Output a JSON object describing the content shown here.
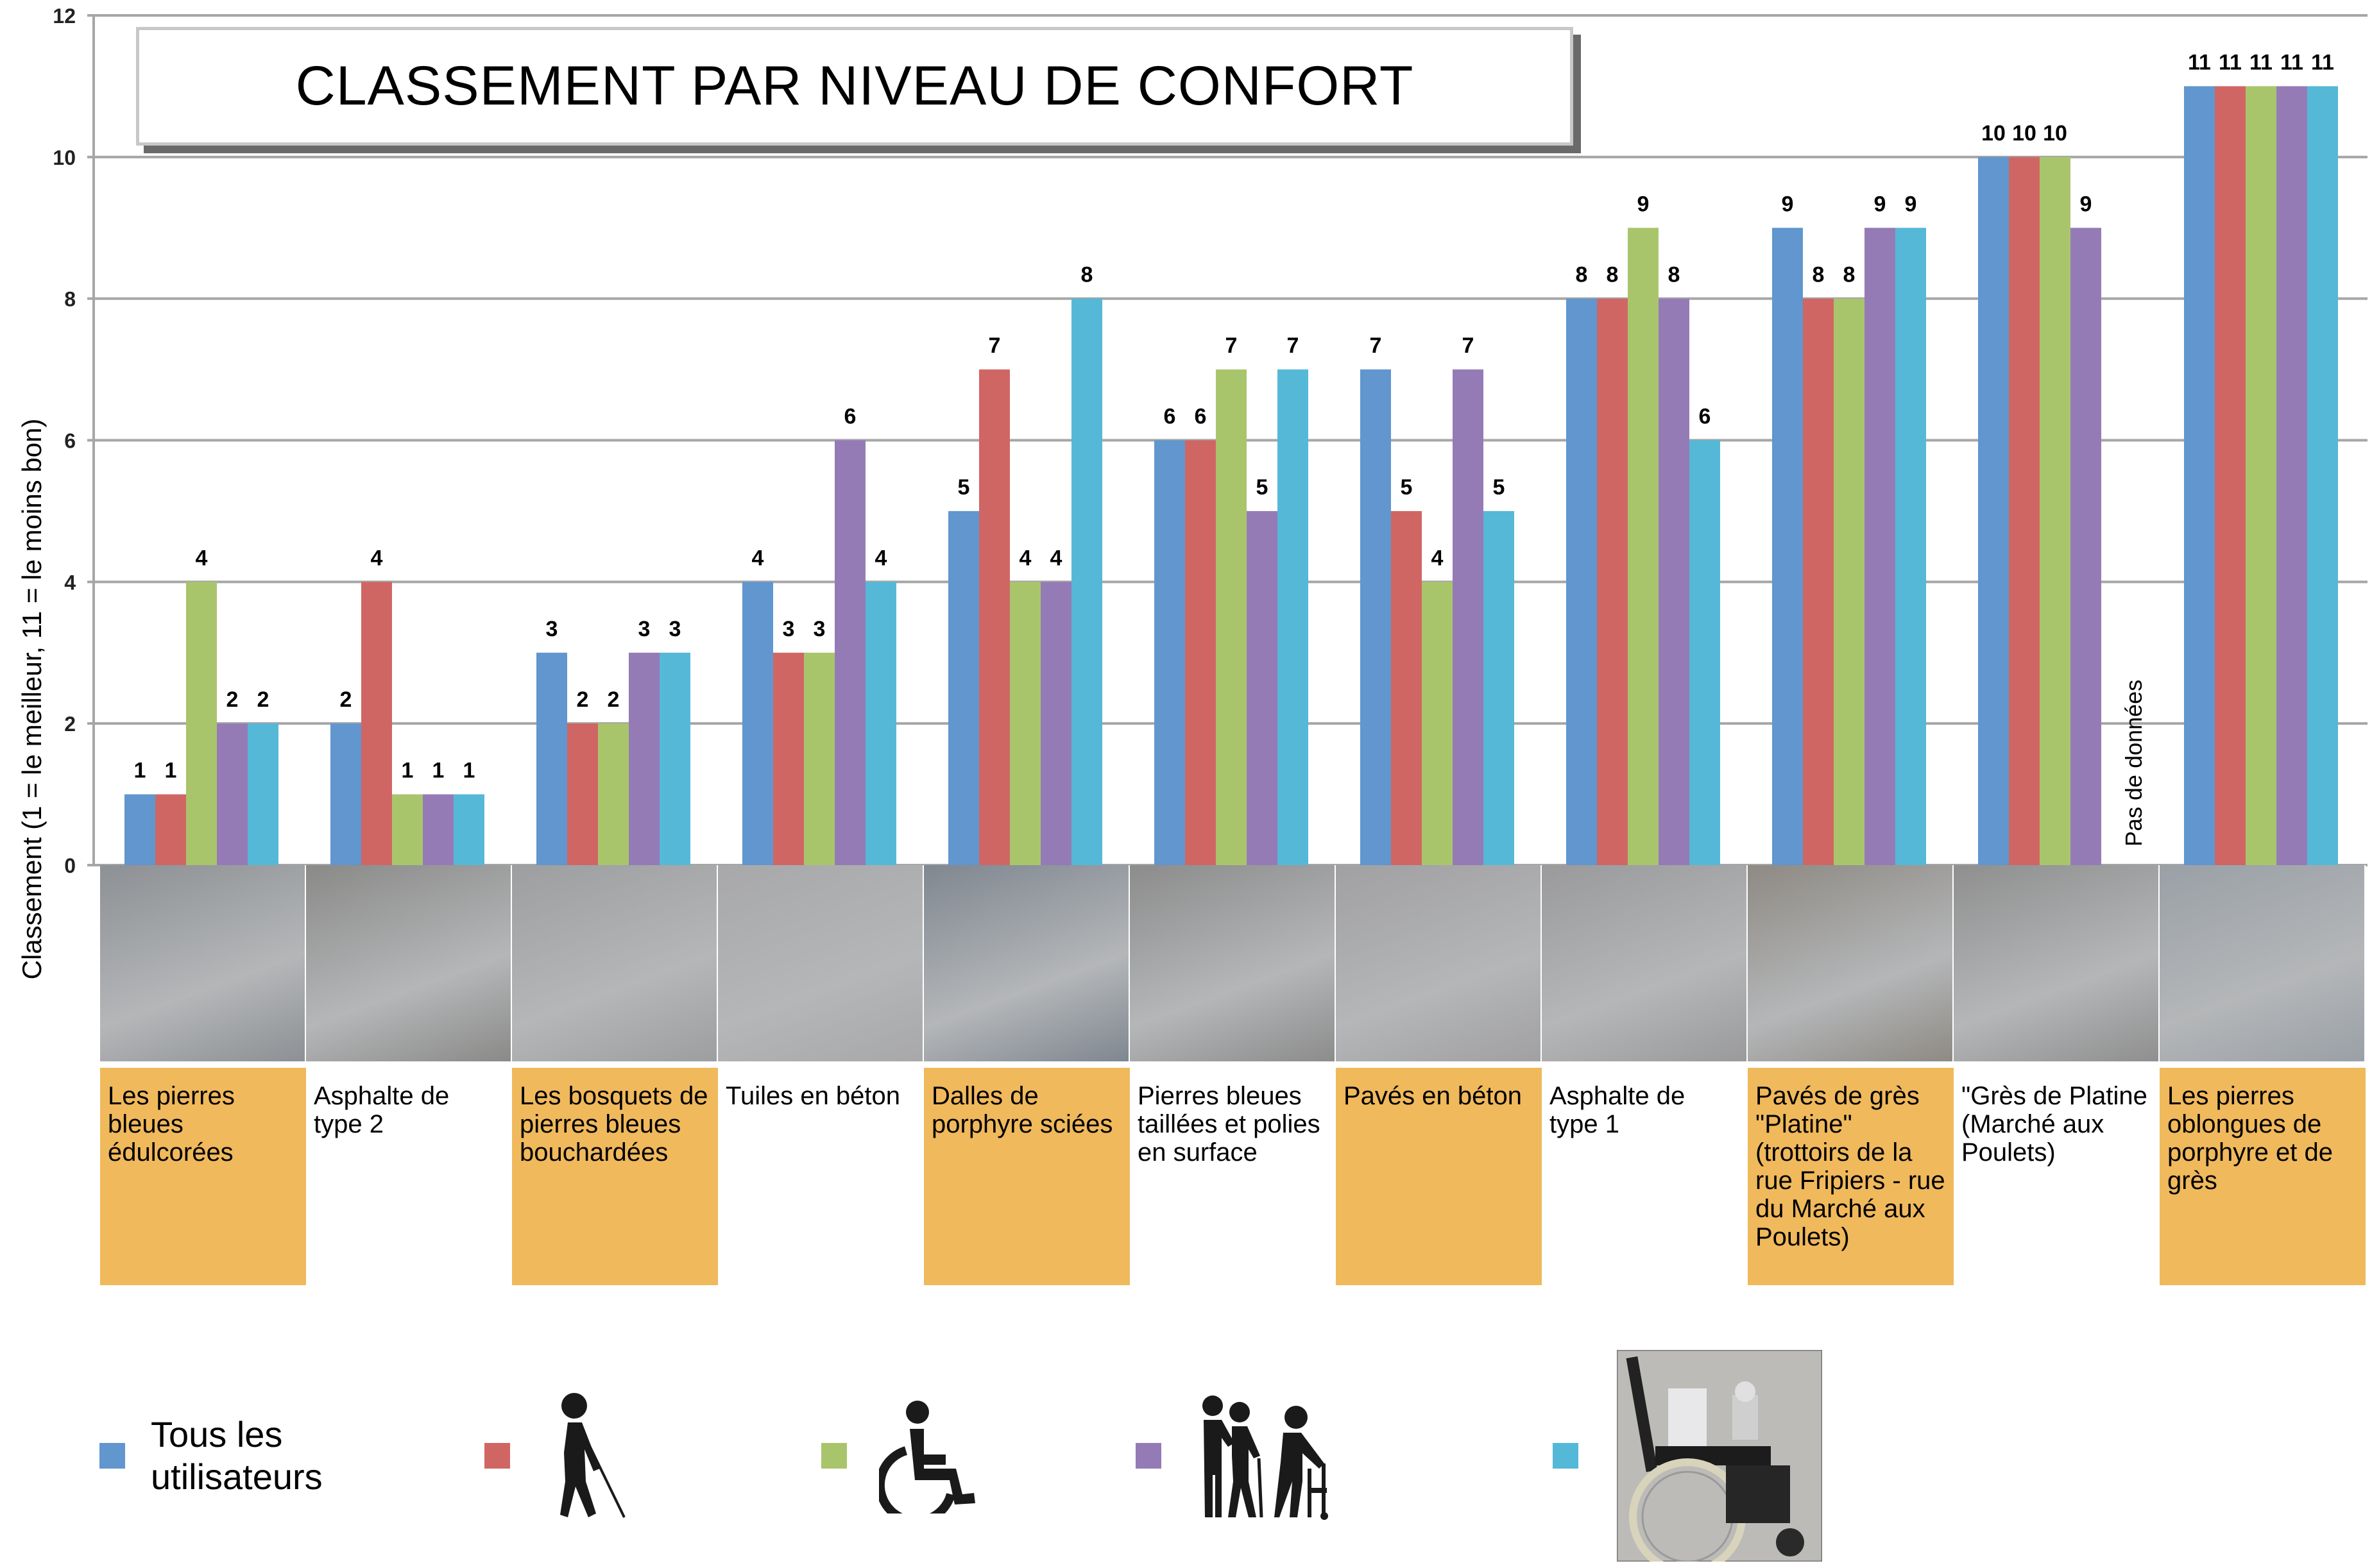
{
  "chart_data": {
    "type": "bar",
    "title": "CLASSEMENT PAR NIVEAU DE CONFORT",
    "xlabel": "",
    "ylabel": "Classement (1 = le meilleur, 11 = le moins bon)",
    "ylim": [
      0,
      12
    ],
    "yticks": [
      0,
      2,
      4,
      6,
      8,
      10,
      12
    ],
    "grid": true,
    "legend_position": "bottom",
    "categories": [
      "Les pierres bleues édulcorées",
      "Asphalte de type 2",
      "Les bosquets de pierres bleues bouchardées",
      "Tuiles en béton",
      "Dalles de porphyre sciées",
      "Pierres bleues taillées et polies en surface",
      "Pavés en béton",
      "Asphalte de type 1",
      "Pavés de grès \"Platine\" (trottoirs de la rue Fripiers - rue du Marché aux Poulets)",
      "\"Grès de Platine (Marché aux Poulets)",
      "Les pierres oblongues de porphyre et de grès"
    ],
    "highlighted_categories": [
      true,
      false,
      true,
      false,
      true,
      false,
      true,
      false,
      true,
      false,
      true
    ],
    "series": [
      {
        "name": "Tous les utilisateurs",
        "icon": "all-users",
        "color": "#6196cf",
        "values": [
          1,
          2,
          3,
          4,
          5,
          6,
          7,
          8,
          9,
          10,
          11
        ]
      },
      {
        "name": "Malvoyants",
        "icon": "blind-person-cane-icon",
        "color": "#d06664",
        "values": [
          1,
          4,
          2,
          3,
          7,
          6,
          5,
          8,
          8,
          10,
          11
        ]
      },
      {
        "name": "Fauteuil roulant",
        "icon": "wheelchair-icon",
        "color": "#a9c56c",
        "values": [
          4,
          1,
          2,
          3,
          4,
          7,
          4,
          9,
          8,
          10,
          11
        ]
      },
      {
        "name": "Personnes âgées",
        "icon": "elderly-walker-icon",
        "color": "#957bb6",
        "values": [
          2,
          1,
          3,
          6,
          4,
          5,
          7,
          8,
          9,
          9,
          11
        ]
      },
      {
        "name": "Fauteuil roulant électrique",
        "icon": "wheelchair-photo",
        "color": "#55b8d7",
        "values": [
          2,
          1,
          3,
          4,
          8,
          7,
          5,
          6,
          9,
          null,
          11
        ]
      }
    ],
    "annotations": [
      {
        "category_index": 9,
        "series_index": 4,
        "text": "Pas de données"
      }
    ]
  },
  "legend": {
    "all_users_label": "Tous les utilisateurs"
  },
  "colors": {
    "label_highlight": "#f0b95c",
    "grid": "#a6a6a6"
  }
}
